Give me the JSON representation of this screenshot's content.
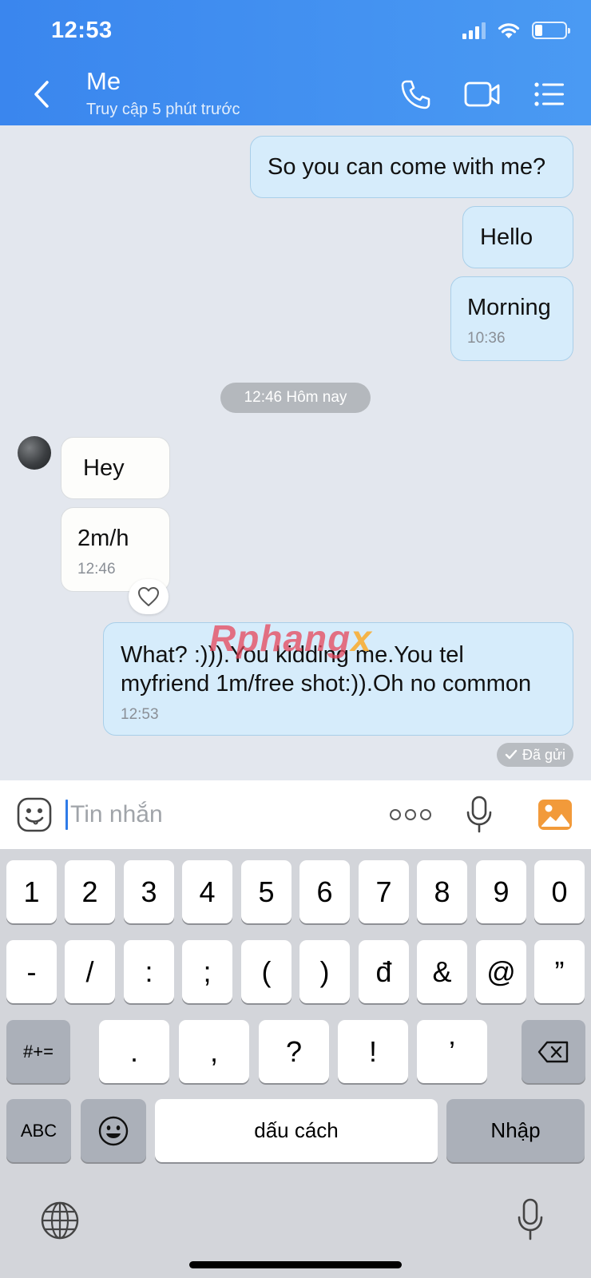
{
  "status_bar": {
    "time": "12:53"
  },
  "header": {
    "name": "Me",
    "subtitle": "Truy cập 5 phút trước",
    "icons": [
      "back-chevron-icon",
      "phone-icon",
      "video-call-icon",
      "list-menu-icon"
    ]
  },
  "messages": {
    "m1": {
      "text": "So you can come with me?"
    },
    "m2": {
      "text": "Hello"
    },
    "m3": {
      "text": "Morning",
      "time": "10:36"
    },
    "separator": "12:46 Hôm nay",
    "m4": {
      "text": "Hey"
    },
    "m5": {
      "text": "2m/h",
      "time": "12:46"
    },
    "m6": {
      "text": "What? :))).You kidding me.You tel myfriend 1m/free shot:)).Oh no common",
      "time": "12:53"
    },
    "sent_status": "Đã gửi"
  },
  "watermark": {
    "main": "Rphang",
    "accent": "x"
  },
  "input": {
    "placeholder": "Tin nhắn",
    "value": ""
  },
  "keyboard": {
    "row1": [
      "1",
      "2",
      "3",
      "4",
      "5",
      "6",
      "7",
      "8",
      "9",
      "0"
    ],
    "row2": [
      "-",
      "/",
      ":",
      ";",
      "(",
      ")",
      "đ",
      "&",
      "@",
      "”"
    ],
    "row3": [
      ".",
      ",",
      "?",
      "!",
      "’"
    ],
    "symbols_key": "#+=",
    "abc_key": "ABC",
    "space_key": "dấu cách",
    "return_key": "Nhập"
  },
  "colors": {
    "header_start": "#3a86ee",
    "header_end": "#4a9af3",
    "out_bubble": "#d6ecfb",
    "in_bubble": "#fdfdfb",
    "chat_bg": "#e3e7ee",
    "keyboard_bg": "#d3d5da"
  }
}
